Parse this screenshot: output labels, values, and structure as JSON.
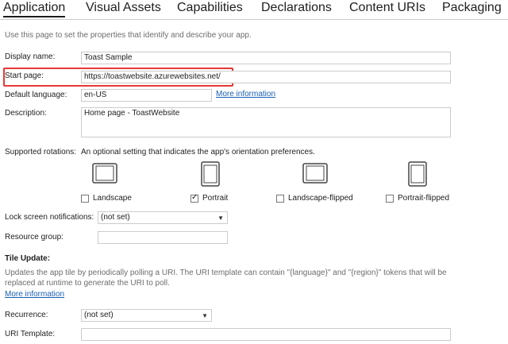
{
  "tabs": [
    {
      "label": "Application",
      "active": true
    },
    {
      "label": "Visual Assets",
      "active": false
    },
    {
      "label": "Capabilities",
      "active": false
    },
    {
      "label": "Declarations",
      "active": false
    },
    {
      "label": "Content URIs",
      "active": false
    },
    {
      "label": "Packaging",
      "active": false
    }
  ],
  "intro": "Use this page to set the properties that identify and describe your app.",
  "display_name": {
    "label": "Display name:",
    "value": "Toast Sample"
  },
  "start_page": {
    "label": "Start page:",
    "value": "https://toastwebsite.azurewebsites.net/"
  },
  "default_language": {
    "label": "Default language:",
    "value": "en-US",
    "link": "More information"
  },
  "description": {
    "label": "Description:",
    "value": "Home page - ToastWebsite"
  },
  "rotations": {
    "label": "Supported rotations:",
    "hint": "An optional setting that indicates the app's orientation preferences.",
    "options": [
      {
        "label": "Landscape",
        "checked": false,
        "icon": "landscape-device-icon"
      },
      {
        "label": "Portrait",
        "checked": true,
        "icon": "portrait-device-icon"
      },
      {
        "label": "Landscape-flipped",
        "checked": false,
        "icon": "landscape-flipped-device-icon"
      },
      {
        "label": "Portrait-flipped",
        "checked": false,
        "icon": "portrait-flipped-device-icon"
      }
    ]
  },
  "lock_screen": {
    "label": "Lock screen notifications:",
    "value": "(not set)"
  },
  "resource_group": {
    "label": "Resource group:",
    "value": ""
  },
  "tile_update": {
    "title": "Tile Update:",
    "description": "Updates the app tile by periodically polling a URI. The URI template can contain \"{language}\" and \"{region}\" tokens that will be replaced at runtime to generate the URI to poll.",
    "link": "More information"
  },
  "recurrence": {
    "label": "Recurrence:",
    "value": "(not set)"
  },
  "uri_template": {
    "label": "URI Template:",
    "value": ""
  },
  "colors": {
    "accent": "#1a5fb4",
    "highlight": "#e53935"
  }
}
